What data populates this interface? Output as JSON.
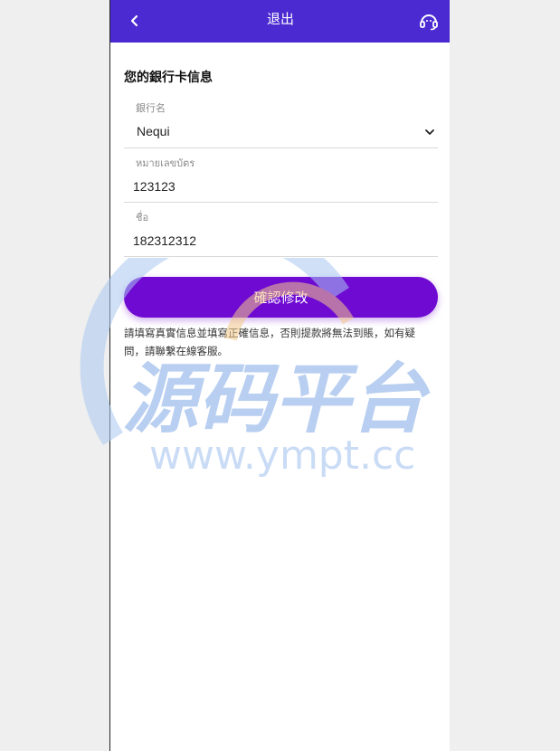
{
  "header": {
    "title": "退出",
    "back_icon": "chevron-left-icon",
    "support_icon": "headset-icon",
    "background": "#4b2ad1"
  },
  "section_title": "您的銀行卡信息",
  "fields": {
    "bank_name": {
      "label": "銀行名",
      "value": "Nequi"
    },
    "card_number": {
      "label": "หมายเลขบัตร",
      "value": "123123"
    },
    "name": {
      "label": "ชื่อ",
      "value": "182312312"
    }
  },
  "confirm_button": {
    "label": "確認修改",
    "color": "#6f0ad2"
  },
  "notice": "請填寫真實信息並填寫正確信息，否則提款將無法到賬，如有疑問，請聯繫在線客服。",
  "watermark": {
    "title": "源码平台",
    "url": "www.ympt.cc"
  }
}
